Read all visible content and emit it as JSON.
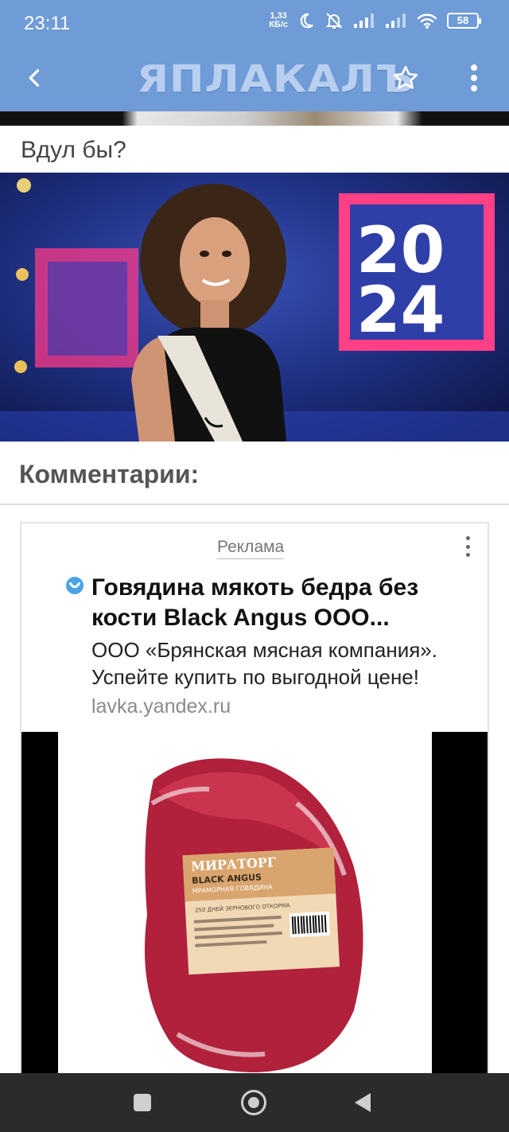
{
  "status_bar": {
    "time": "23:11",
    "net_speed_value": "1,33",
    "net_speed_unit": "КБ/с",
    "battery": "58",
    "icons": [
      "moon-icon",
      "mute-icon",
      "signal-icon",
      "signal-icon",
      "wifi-icon",
      "battery-icon"
    ]
  },
  "app_bar": {
    "logo": "ЯПЛАКАЛЪ",
    "icons": [
      "back-arrow-icon",
      "star-icon",
      "more-vertical-icon"
    ]
  },
  "post": {
    "caption": "Вдул бы?"
  },
  "comments": {
    "heading": "Комментарии:"
  },
  "ad": {
    "label": "Реклама",
    "title": "Говядина мякоть бедра без кости Black Angus ООО...",
    "text": "ООО «Брянская мясная компания». Успейте купить по выгодной цене!",
    "domain": "lavka.yandex.ru",
    "package_brand": "МИРАТОРГ",
    "package_line1": "BLACK ANGUS",
    "package_line2": "МРАМОРНАЯ ГОВЯДИНА",
    "package_line3": "250 ДНЕЙ ЗЕРНОВОГО ОТКОРМА"
  },
  "colors": {
    "app_bar": "#6f9bd6",
    "nav_bar": "#2b2b2b",
    "verified_badge": "#4aa3e8"
  }
}
